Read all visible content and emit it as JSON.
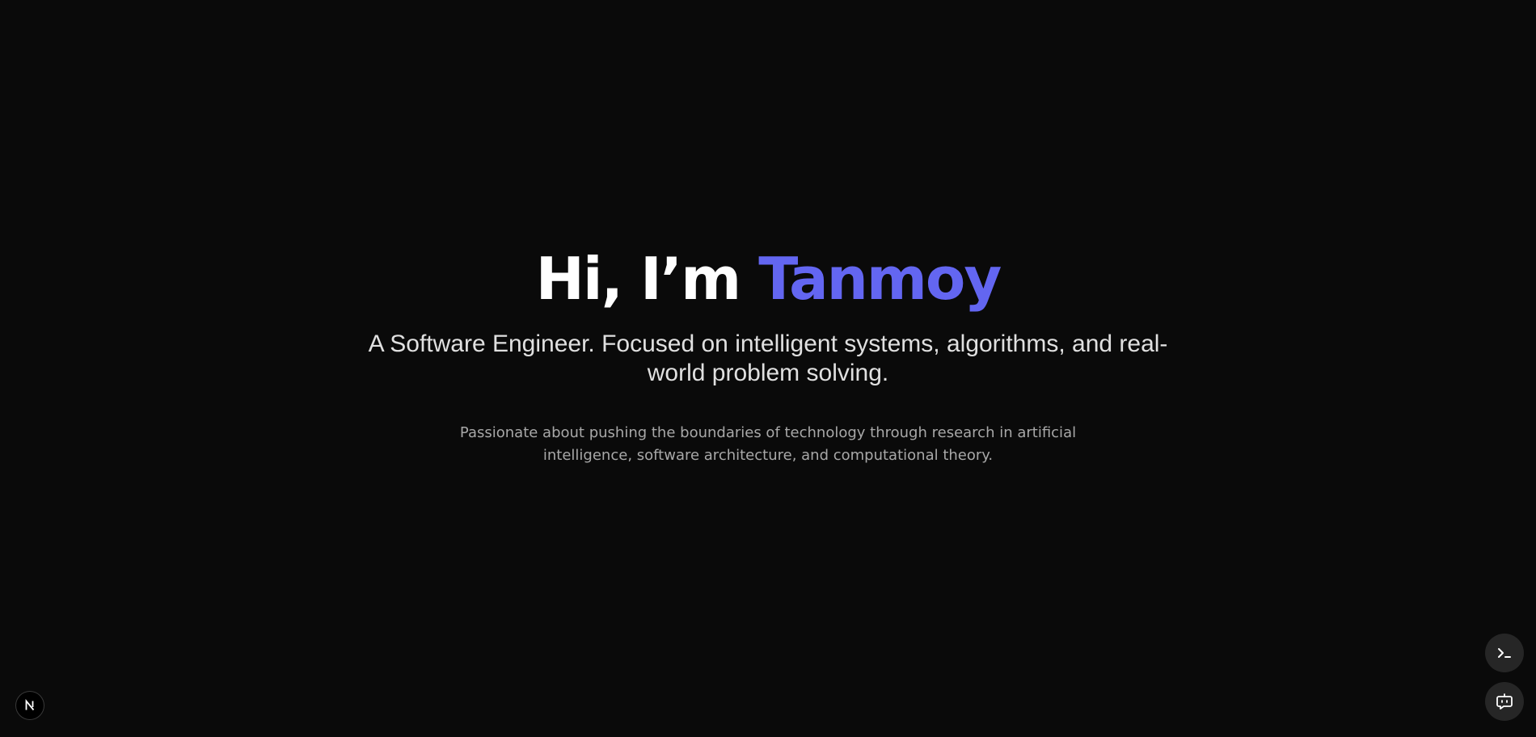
{
  "hero": {
    "greeting": "Hi, I’m ",
    "name": "Tanmoy",
    "tagline": "A Software Engineer. Focused on intelligent systems, algorithms, and real-world problem solving.",
    "description": "Passionate about pushing the boundaries of technology through research in artificial intelligence, software architecture, and computational theory."
  },
  "colors": {
    "background": "#0a0a0a",
    "accent": "#6366f1",
    "heading": "#ffffff",
    "tagline": "#e0e0e0",
    "body": "#a8a8a8",
    "fab": "#262626"
  },
  "icons": {
    "dev_badge": "nextjs-logo-icon",
    "terminal_button": "terminal-icon",
    "chat_button": "chatbot-icon"
  }
}
